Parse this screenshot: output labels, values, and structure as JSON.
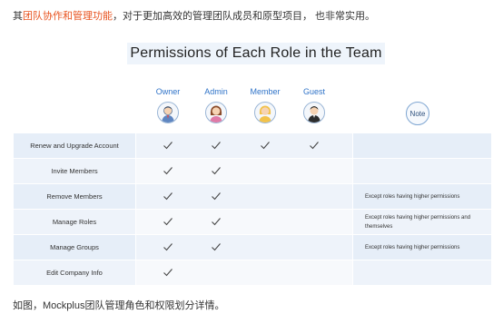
{
  "intro": {
    "prefix": "其",
    "highlight": "团队协作和管理功能",
    "suffix": "，对于更加高效的管理团队成员和原型项目， 也非常实用。"
  },
  "title": "Permissions of Each Role in the Team",
  "roles": [
    "Owner",
    "Admin",
    "Member",
    "Guest"
  ],
  "note_label": "Note",
  "rows": [
    {
      "label": "Renew and Upgrade Account",
      "checks": [
        true,
        true,
        true,
        true
      ],
      "note": ""
    },
    {
      "label": "Invite Members",
      "checks": [
        true,
        true,
        false,
        false
      ],
      "note": ""
    },
    {
      "label": "Remove Members",
      "checks": [
        true,
        true,
        false,
        false
      ],
      "note": "Except roles having higher permissions"
    },
    {
      "label": "Manage Roles",
      "checks": [
        true,
        true,
        false,
        false
      ],
      "note": "Except roles having higher permissions and themselves"
    },
    {
      "label": "Manage Groups",
      "checks": [
        true,
        true,
        false,
        false
      ],
      "note": "Except roles having higher permissions"
    },
    {
      "label": "Edit Company Info",
      "checks": [
        true,
        false,
        false,
        false
      ],
      "note": ""
    }
  ],
  "outro": "如图，Mockplus团队管理角色和权限划分详情。",
  "colors": {
    "highlight": "#e8531f",
    "role": "#2f73c8"
  }
}
